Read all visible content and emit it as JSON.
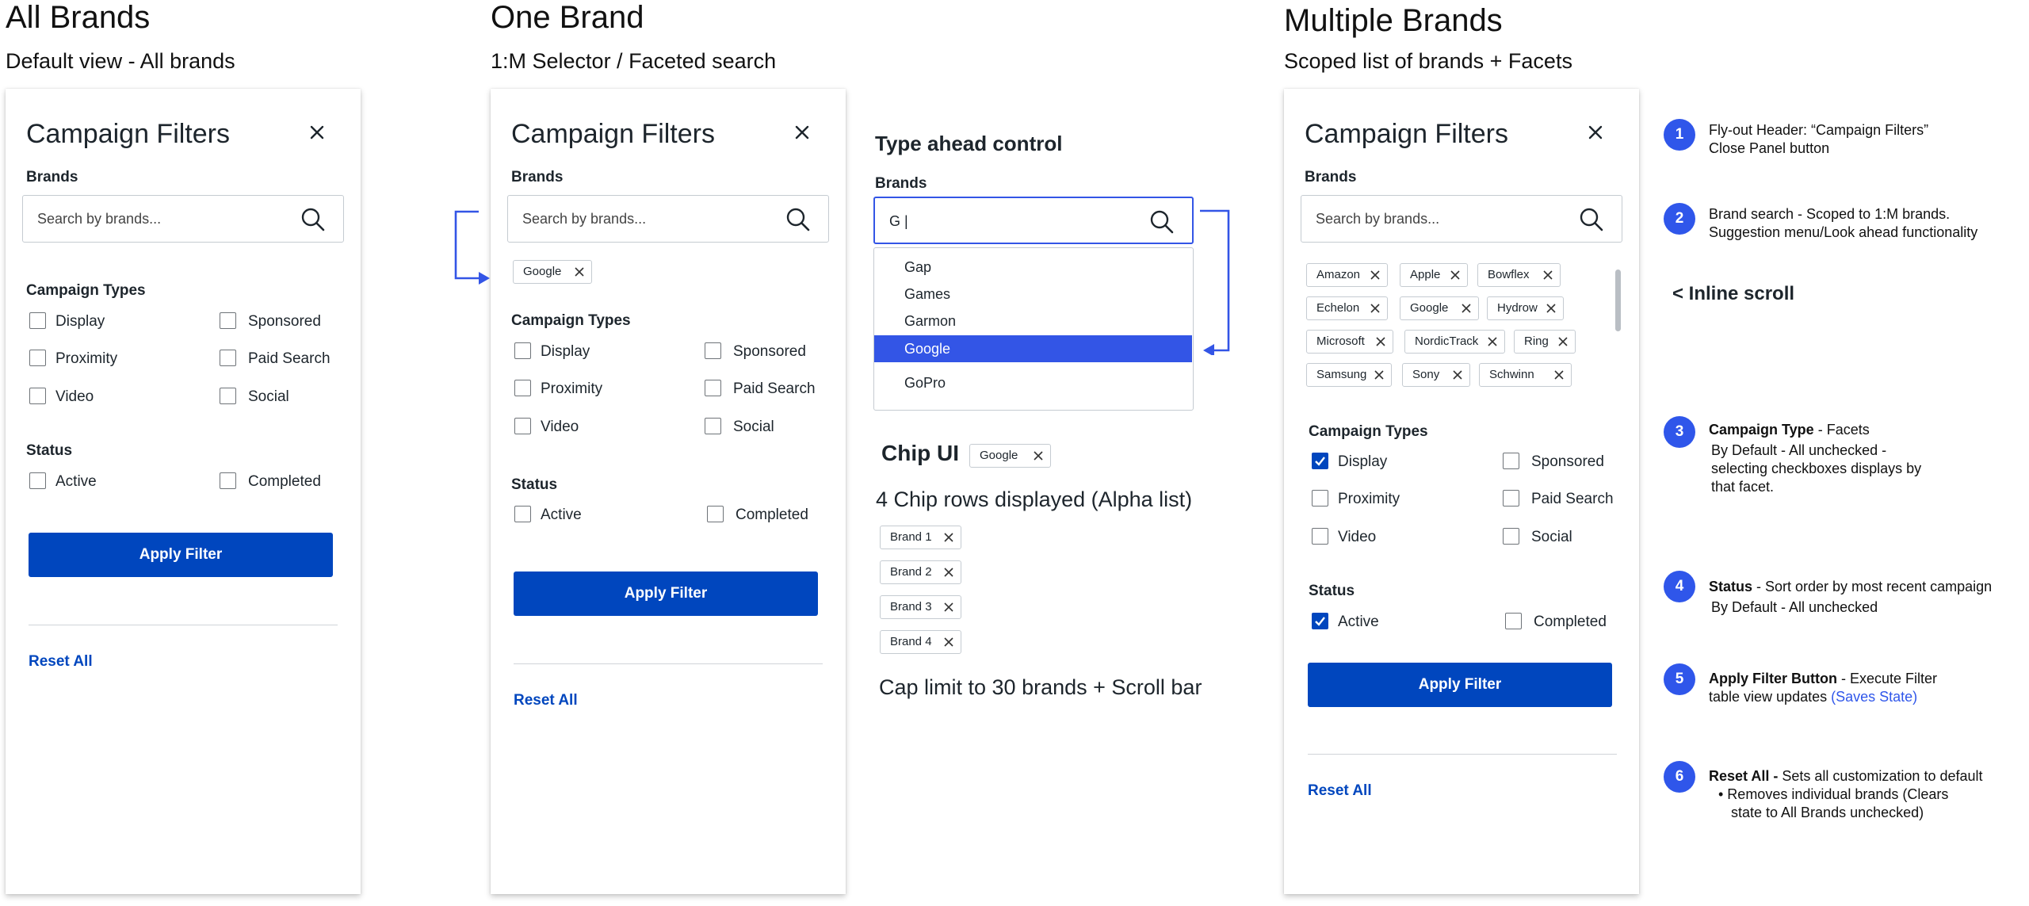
{
  "sections": {
    "all": {
      "title": "All Brands",
      "subtitle": "Default view - All brands"
    },
    "one": {
      "title": "One Brand",
      "subtitle": "1:M Selector / Faceted search"
    },
    "multi": {
      "title": "Multiple Brands",
      "subtitle": "Scoped list of brands + Facets"
    }
  },
  "panel": {
    "title": "Campaign Filters",
    "brands_label": "Brands",
    "search_placeholder": "Search by brands...",
    "campaign_types_label": "Campaign Types",
    "types": [
      "Display",
      "Sponsored",
      "Proximity",
      "Paid Search",
      "Video",
      "Social"
    ],
    "status_label": "Status",
    "statuses": [
      "Active",
      "Completed"
    ],
    "apply_label": "Apply Filter",
    "reset_label": "Reset All"
  },
  "one_brand": {
    "chip": "Google"
  },
  "typeahead": {
    "title": "Type ahead control",
    "brands_label": "Brands",
    "query": "G |",
    "options": [
      "Gap",
      "Games",
      "Garmon",
      "Google",
      "GoPro"
    ],
    "selected": "Google"
  },
  "chip_ui": {
    "title": "Chip UI",
    "example_chip": "Google",
    "rows_title": "4 Chip rows displayed (Alpha list)",
    "chips": [
      "Brand 1",
      "Brand 2",
      "Brand 3",
      "Brand 4"
    ],
    "cap_text": "Cap limit to 30 brands + Scroll bar"
  },
  "multi_brand": {
    "chips": [
      [
        "Amazon",
        "Apple",
        "Bowflex"
      ],
      [
        "Echelon",
        "Google",
        "Hydrow"
      ],
      [
        "Microsoft",
        "NordicTrack",
        "Ring"
      ],
      [
        "Samsung",
        "Sony",
        "Schwinn"
      ]
    ],
    "checked": [
      "Display",
      "Active"
    ]
  },
  "inline_scroll_label": "< Inline scroll",
  "notes": [
    {
      "num": "1",
      "l1": "Fly-out Header: “Campaign Filters”",
      "l2": "Close Panel button"
    },
    {
      "num": "2",
      "l1": "Brand search -  Scoped to 1:M brands.",
      "l2": "Suggestion menu/Look ahead functionality"
    },
    {
      "num": "3",
      "bold": "Campaign Type",
      "rest": " - Facets",
      "l2": "By Default - All unchecked -",
      "l3": "selecting checkboxes displays by",
      "l4": "that facet."
    },
    {
      "num": "4",
      "bold": "Status",
      "rest": " - Sort order by most recent campaign",
      "l2": "By Default - All unchecked"
    },
    {
      "num": "5",
      "bold": "Apply Filter Button",
      "rest": " - Execute Filter",
      "l2": "table view updates ",
      "l2_blue": "(Saves State)"
    },
    {
      "num": "6",
      "bold": "Reset All -",
      "rest": " Sets all customization to default",
      "l2": "•  Removes individual brands (Clears",
      "l3": "state to All Brands unchecked)"
    }
  ],
  "colors": {
    "primary": "#0046be",
    "accent": "#2f56ea",
    "highlight": "#3355e6",
    "border": "#c5cbd1"
  }
}
